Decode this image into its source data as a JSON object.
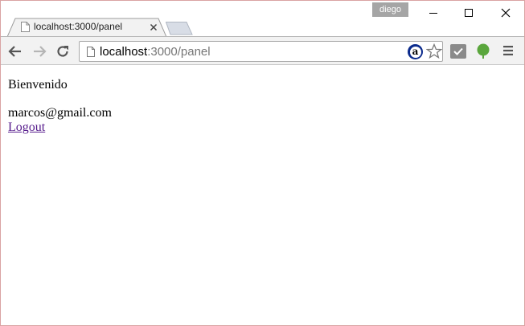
{
  "browser": {
    "profile_name": "diego",
    "tab": {
      "title": "localhost:3000/panel"
    },
    "address": {
      "host": "localhost",
      "path": ":3000/panel"
    }
  },
  "page": {
    "greeting": "Bienvenido",
    "email": "marcos@gmail.com",
    "logout_label": "Logout"
  },
  "colors": {
    "visited_link": "#551a8b",
    "toolbar_bg": "#f2f2f2",
    "window_border": "#d9a3a3",
    "evernote_green": "#5aa63c"
  }
}
